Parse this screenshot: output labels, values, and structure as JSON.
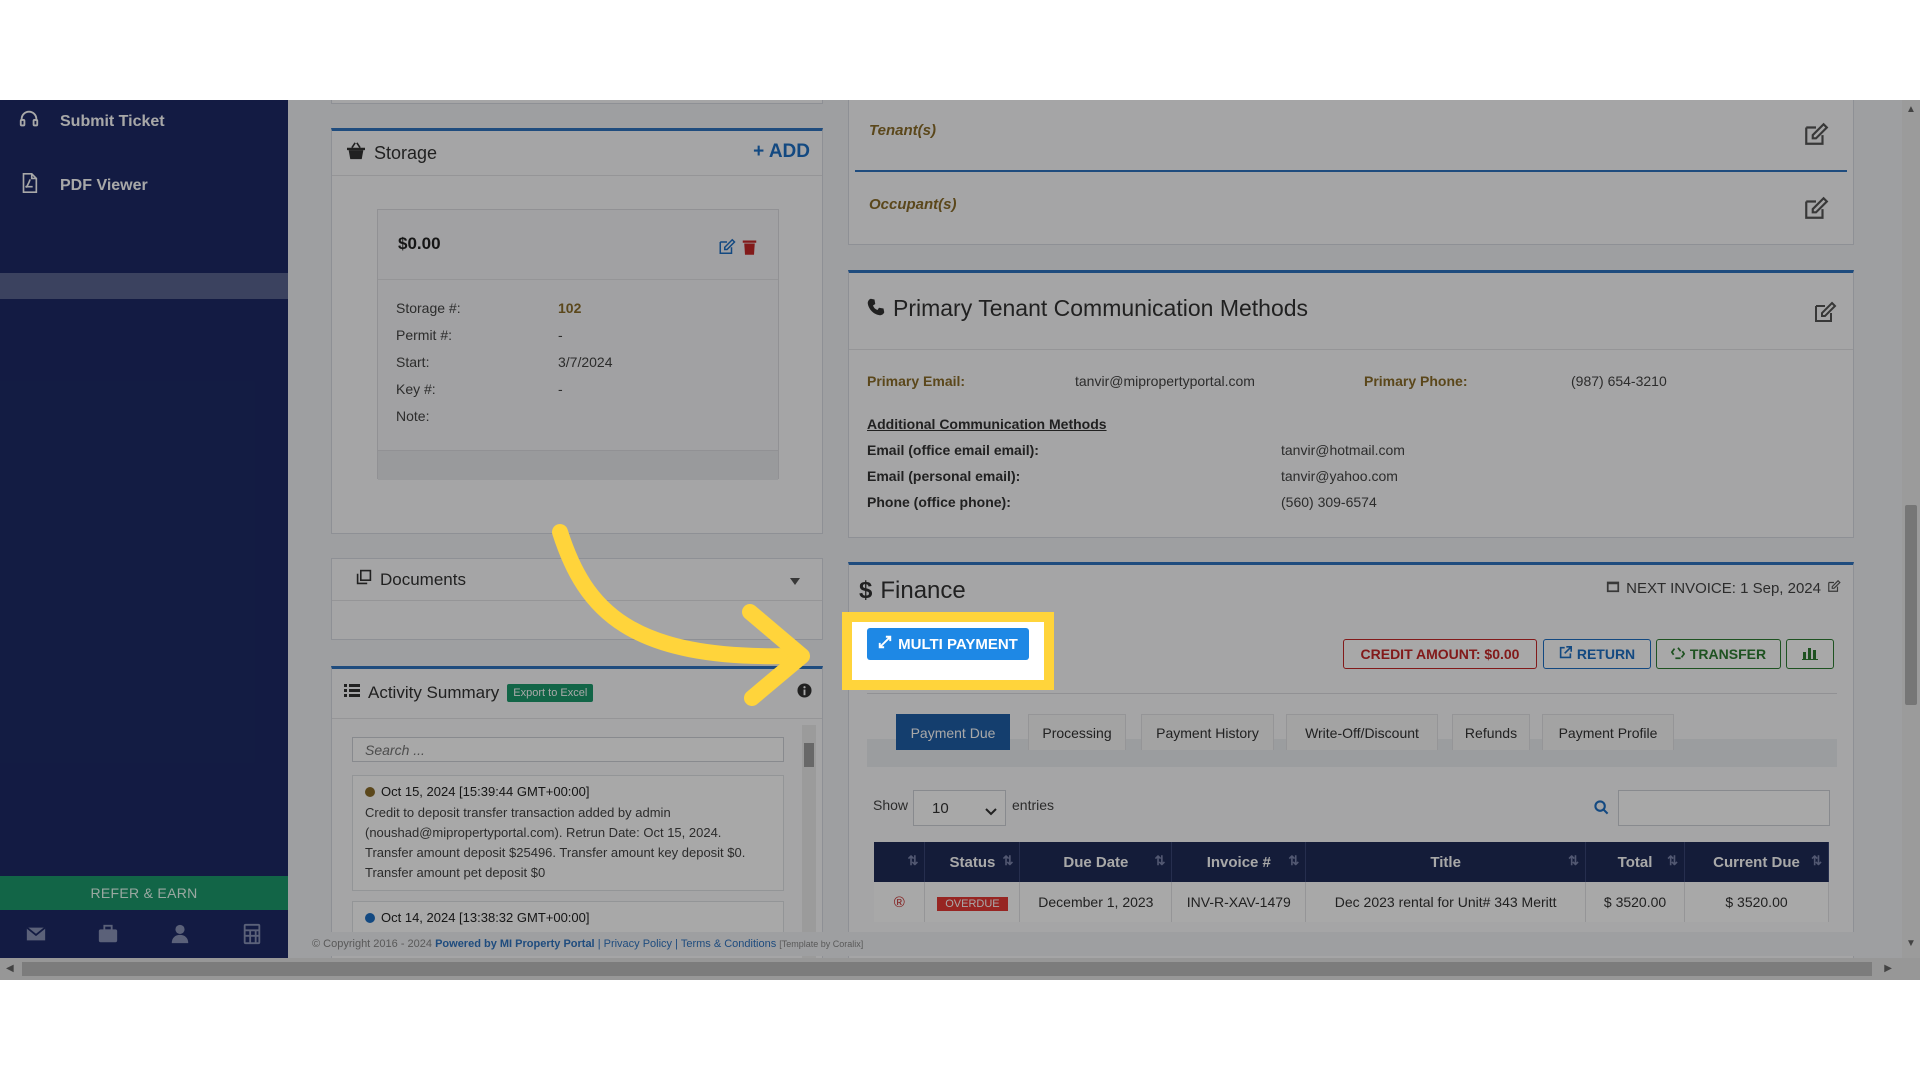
{
  "sidebar": {
    "items": [
      {
        "label": "Submit Ticket",
        "icon": "headset-icon"
      },
      {
        "label": "PDF Viewer",
        "icon": "pdf-file-icon"
      }
    ],
    "refer_label": "REFER & EARN",
    "bottom_icons": [
      "envelope-icon",
      "briefcase-icon",
      "user-icon",
      "calculator-icon"
    ]
  },
  "storage": {
    "title": "Storage",
    "add_label": "+ ADD",
    "card": {
      "amount": "$0.00",
      "rows": [
        {
          "label": "Storage #:",
          "value": "102"
        },
        {
          "label": "Permit #:",
          "value": "-"
        },
        {
          "label": "Start:",
          "value": "3/7/2024"
        },
        {
          "label": "Key #:",
          "value": "-"
        },
        {
          "label": "Note:",
          "value": ""
        }
      ]
    }
  },
  "documents": {
    "title": "Documents"
  },
  "activity": {
    "title": "Activity Summary",
    "export_label": "Export to Excel",
    "search_placeholder": "Search ...",
    "entries": [
      {
        "date": "Oct 15, 2024 [15:39:44 GMT+00:00]",
        "text": "Credit to deposit transfer transaction added by admin (noushad@mipropertyportal.com). Retrun Date: Oct 15, 2024. Transfer amount deposit $25496. Transfer amount key deposit $0. Transfer amount pet deposit $0",
        "dot": "#8a6d2a"
      },
      {
        "date": "Oct 14, 2024 [13:38:32 GMT+00:00]",
        "text": "",
        "dot": "#1e6fc4"
      }
    ]
  },
  "people": {
    "tenants_label": "Tenant(s)",
    "occupants_label": "Occupant(s)"
  },
  "communication": {
    "title": "Primary Tenant Communication Methods",
    "primary_email_label": "Primary Email:",
    "primary_email": "tanvir@mipropertyportal.com",
    "primary_phone_label": "Primary Phone:",
    "primary_phone": "(987) 654-3210",
    "additional_label": "Additional Communication Methods",
    "additional": [
      {
        "label": "Email (office email email):",
        "value": "tanvir@hotmail.com"
      },
      {
        "label": "Email (personal email):",
        "value": "tanvir@yahoo.com"
      },
      {
        "label": "Phone (office phone):",
        "value": "(560) 309-6574"
      }
    ]
  },
  "finance": {
    "title": "Finance",
    "next_invoice": "NEXT INVOICE: 1 Sep, 2024",
    "multi_payment_label": "MULTI PAYMENT",
    "credit_label": "CREDIT AMOUNT: $0.00",
    "return_label": "RETURN",
    "transfer_label": "TRANSFER",
    "tabs": [
      "Payment Due",
      "Processing",
      "Payment History",
      "Write-Off/Discount",
      "Refunds",
      "Payment Profile"
    ],
    "show_label": "Show",
    "entries_value": "10",
    "entries_label": "entries",
    "columns": [
      "",
      "Status",
      "Due Date",
      "Invoice #",
      "Title",
      "Total",
      "Current Due"
    ],
    "rows": [
      {
        "status": "OVERDUE",
        "due_date": "December 1, 2023",
        "invoice": "INV-R-XAV-1479",
        "title": "Dec 2023 rental for Unit# 343 Meritt",
        "total": "$ 3520.00",
        "current_due": "$ 3520.00"
      }
    ]
  },
  "footer": {
    "copyright": "© Copyright 2016 - 2024",
    "powered": "Powered by MI Property Portal",
    "links": "| Privacy Policy | Terms & Conditions",
    "template": "[Template by Coralix]"
  },
  "colors": {
    "accent": "#1e88e5",
    "sidebar": "#1d2a66",
    "highlight": "#ffd43b",
    "danger": "#c62828",
    "success": "#2e7d32"
  }
}
